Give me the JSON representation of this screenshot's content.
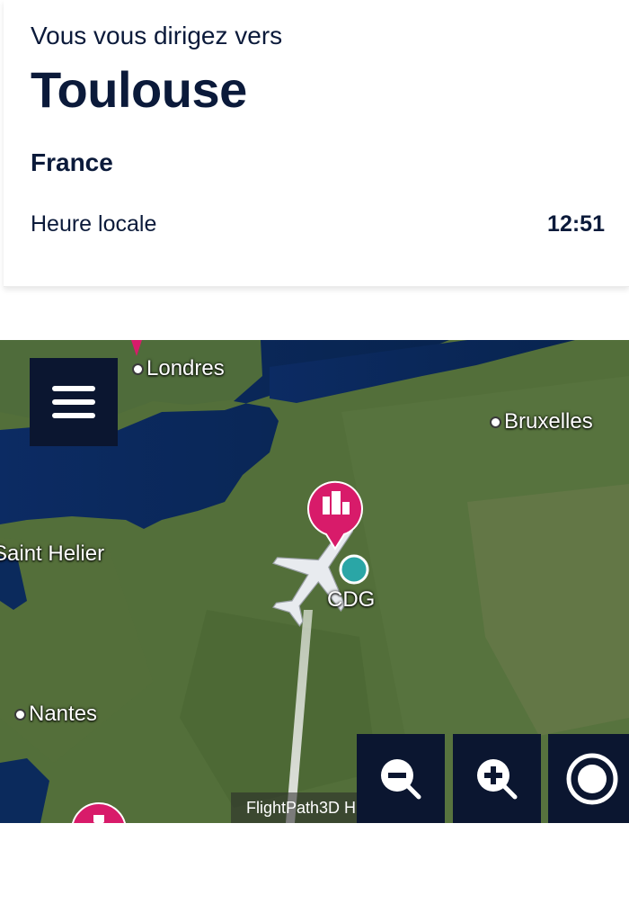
{
  "destination": {
    "heading": "Vous vous dirigez vers",
    "city": "Toulouse",
    "country": "France",
    "local_time_label": "Heure locale",
    "local_time_value": "12:51"
  },
  "map": {
    "labels": {
      "london": "Londres",
      "brussels": "Bruxelles",
      "saint_helier": "Saint Helier",
      "nantes": "Nantes",
      "airport": "CDG"
    },
    "attribution": "FlightPath3D H",
    "controls": {
      "menu_icon": "hamburger-menu-icon",
      "zoom_out_icon": "zoom-out-icon",
      "zoom_in_icon": "zoom-in-icon",
      "recenter_icon": "recenter-icon"
    },
    "colors": {
      "poi_marker": "#d81b6a",
      "airport_dot": "#2aa6a6",
      "control_bg": "#0b1630"
    }
  }
}
